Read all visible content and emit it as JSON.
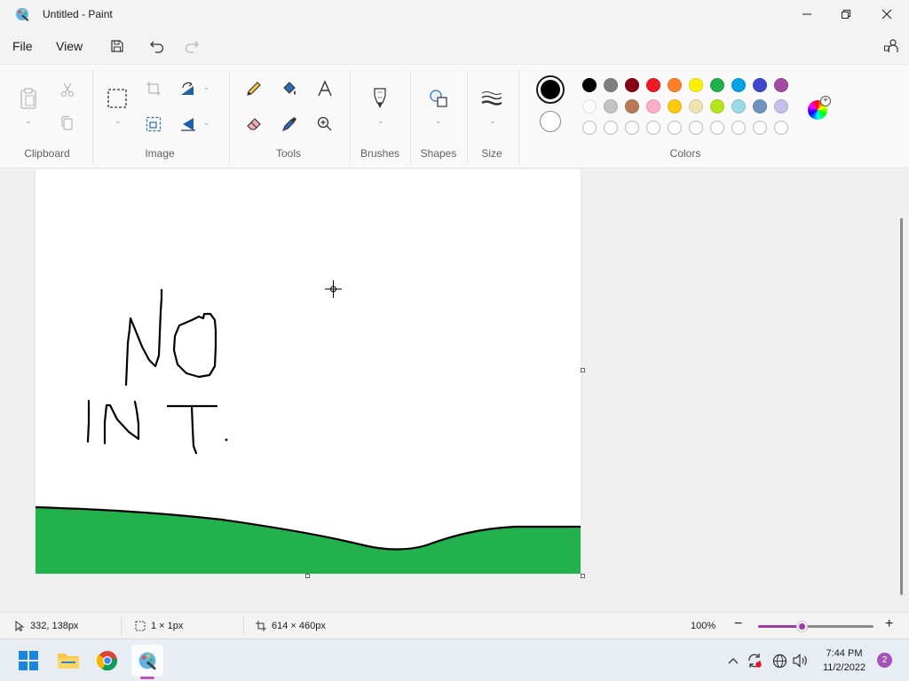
{
  "window": {
    "title": "Untitled - Paint"
  },
  "menu": {
    "file": "File",
    "view": "View"
  },
  "ribbon": {
    "groups": {
      "clipboard": "Clipboard",
      "image": "Image",
      "tools": "Tools",
      "brushes": "Brushes",
      "shapes": "Shapes",
      "size": "Size",
      "colors": "Colors"
    }
  },
  "colors": {
    "primary": "#000000",
    "secondary": "#ffffff",
    "palette_row1": [
      "#000000",
      "#7f7f7f",
      "#880015",
      "#ed1c24",
      "#ff7f27",
      "#fff200",
      "#22b14c",
      "#00a2e8",
      "#3f48cc",
      "#a349a4"
    ],
    "palette_row2": [
      "#ffffff",
      "#c3c3c3",
      "#b97a57",
      "#ffaec9",
      "#ffc90e",
      "#efe4b0",
      "#b5e61d",
      "#99d9ea",
      "#7092be",
      "#c8bfe7"
    ],
    "palette_row3_empty": 10,
    "fill_green": "#22b14c"
  },
  "status": {
    "cursor_position": "332, 138px",
    "selection_size": "1 × 1px",
    "canvas_size": "614 × 460px",
    "zoom": "100%",
    "zoom_slider_percent": 38
  },
  "taskbar": {
    "time": "7:44 PM",
    "date": "11/2/2022",
    "notification_count": "2"
  }
}
